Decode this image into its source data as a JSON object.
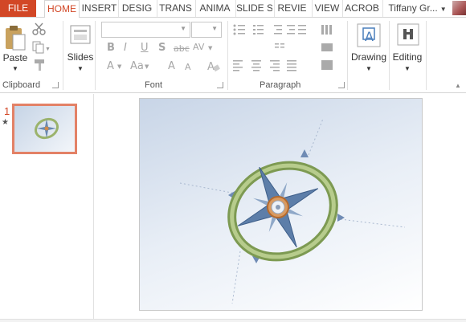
{
  "tabs": [
    {
      "label": "FILE"
    },
    {
      "label": "HOME"
    },
    {
      "label": "INSERT"
    },
    {
      "label": "DESIG"
    },
    {
      "label": "TRANS"
    },
    {
      "label": "ANIMA"
    },
    {
      "label": "SLIDE S"
    },
    {
      "label": "REVIE"
    },
    {
      "label": "VIEW"
    },
    {
      "label": "ACROB"
    }
  ],
  "user": {
    "name": "Tiffany Gr..."
  },
  "ribbon": {
    "clipboard": {
      "paste_label": "Paste",
      "group_label": "Clipboard"
    },
    "slides": {
      "slides_label": "Slides"
    },
    "font": {
      "group_label": "Font",
      "bold": "B",
      "italic": "I",
      "underline": "U",
      "shadow": "S",
      "strike": "abc",
      "spacing": "AV",
      "grow": "A",
      "case": "Aa",
      "color": "A"
    },
    "paragraph": {
      "group_label": "Paragraph"
    },
    "drawing": {
      "label": "Drawing"
    },
    "editing": {
      "label": "Editing"
    }
  },
  "thumbnails": [
    {
      "number": "1",
      "has_animation": true
    }
  ],
  "colors": {
    "accent": "#d24726",
    "thumb_border": "#e38166"
  }
}
